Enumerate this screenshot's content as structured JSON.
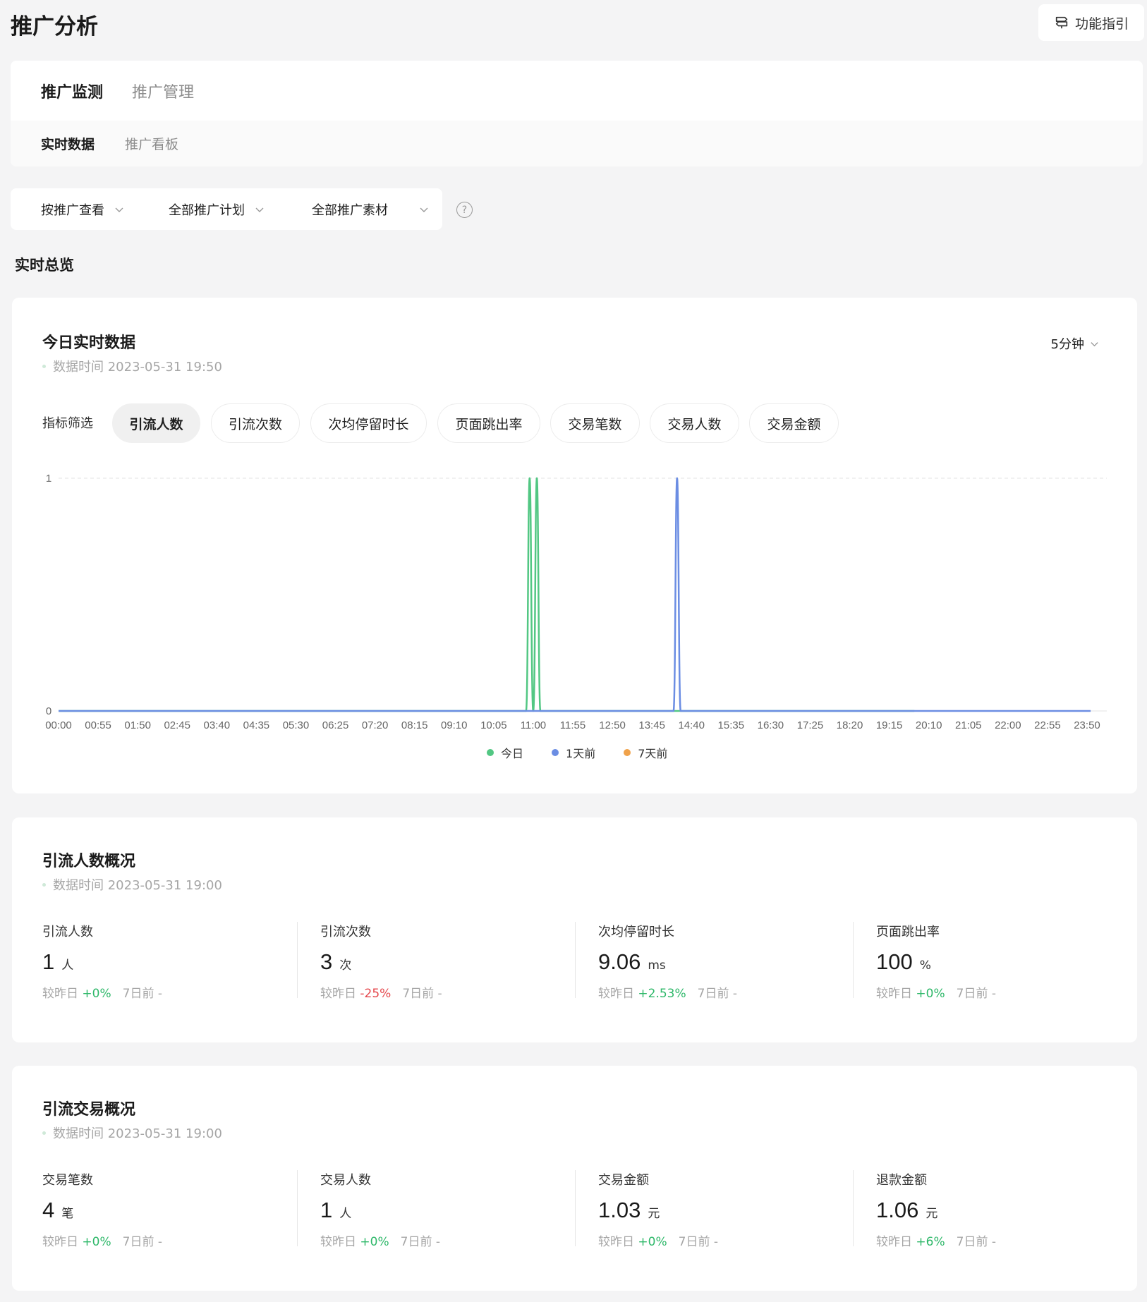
{
  "header": {
    "title": "推广分析",
    "guide_label": "功能指引"
  },
  "tabs": {
    "main": [
      {
        "label": "推广监测"
      },
      {
        "label": "推广管理"
      }
    ],
    "sub": [
      {
        "label": "实时数据"
      },
      {
        "label": "推广看板"
      }
    ]
  },
  "filters": [
    {
      "label": "按推广查看"
    },
    {
      "label": "全部推广计划"
    },
    {
      "label": "全部推广素材"
    }
  ],
  "overview_title": "实时总览",
  "realtime": {
    "title": "今日实时数据",
    "time_label": "数据时间 2023-05-31 19:50",
    "interval": "5分钟",
    "metric_label": "指标筛选",
    "metrics": [
      {
        "label": "引流人数"
      },
      {
        "label": "引流次数"
      },
      {
        "label": "次均停留时长"
      },
      {
        "label": "页面跳出率"
      },
      {
        "label": "交易笔数"
      },
      {
        "label": "交易人数"
      },
      {
        "label": "交易金额"
      }
    ],
    "active_metric": "引流人数"
  },
  "chart_data": {
    "type": "line",
    "ylim": [
      0,
      1
    ],
    "yticks": [
      "0",
      "1"
    ],
    "xticks": [
      "00:00",
      "00:55",
      "01:50",
      "02:45",
      "03:40",
      "04:35",
      "05:30",
      "06:25",
      "07:20",
      "08:15",
      "09:10",
      "10:05",
      "11:00",
      "11:55",
      "12:50",
      "13:45",
      "14:40",
      "15:35",
      "16:30",
      "17:25",
      "18:20",
      "19:15",
      "20:10",
      "21:05",
      "22:00",
      "22:55",
      "23:50"
    ],
    "x_interval_minutes": 5,
    "grid": true,
    "legend_position": "bottom",
    "series": [
      {
        "name": "今日",
        "color": "#52c783",
        "x_range": [
          "00:00",
          "19:50"
        ],
        "peaks": [
          {
            "x": "10:55",
            "y": 1
          },
          {
            "x": "11:05",
            "y": 1
          }
        ]
      },
      {
        "name": "1天前",
        "color": "#6b8de3",
        "x_range": [
          "00:00",
          "23:55"
        ],
        "peaks": [
          {
            "x": "14:20",
            "y": 1
          }
        ]
      },
      {
        "name": "7天前",
        "color": "#f0a24a",
        "x_range": [],
        "peaks": []
      }
    ]
  },
  "traffic": {
    "title": "引流人数概况",
    "time_label": "数据时间 2023-05-31 19:00",
    "stats": [
      {
        "label": "引流人数",
        "value": "1",
        "unit": "人",
        "cmp_label": "较昨日",
        "cmp_value": "+0%",
        "week_label": "7日前 -"
      },
      {
        "label": "引流次数",
        "value": "3",
        "unit": "次",
        "cmp_label": "较昨日",
        "cmp_value": "-25%",
        "week_label": "7日前 -"
      },
      {
        "label": "次均停留时长",
        "value": "9.06",
        "unit": "ms",
        "cmp_label": "较昨日",
        "cmp_value": "+2.53%",
        "week_label": "7日前 -"
      },
      {
        "label": "页面跳出率",
        "value": "100",
        "unit": "%",
        "cmp_label": "较昨日",
        "cmp_value": "+0%",
        "week_label": "7日前 -"
      }
    ]
  },
  "trade": {
    "title": "引流交易概况",
    "time_label": "数据时间 2023-05-31 19:00",
    "stats": [
      {
        "label": "交易笔数",
        "value": "4",
        "unit": "笔",
        "cmp_label": "较昨日",
        "cmp_value": "+0%",
        "week_label": "7日前 -"
      },
      {
        "label": "交易人数",
        "value": "1",
        "unit": "人",
        "cmp_label": "较昨日",
        "cmp_value": "+0%",
        "week_label": "7日前 -"
      },
      {
        "label": "交易金额",
        "value": "1.03",
        "unit": "元",
        "cmp_label": "较昨日",
        "cmp_value": "+0%",
        "week_label": "7日前 -"
      },
      {
        "label": "退款金额",
        "value": "1.06",
        "unit": "元",
        "cmp_label": "较昨日",
        "cmp_value": "+6%",
        "week_label": "7日前 -"
      }
    ]
  }
}
